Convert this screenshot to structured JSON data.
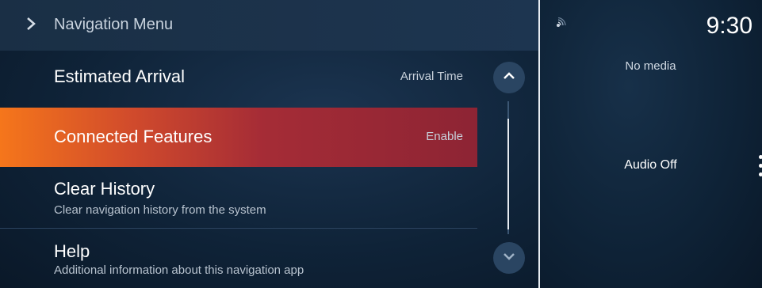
{
  "header": {
    "title": "Navigation Menu"
  },
  "menu": [
    {
      "title": "Estimated Arrival",
      "value": "Arrival Time"
    },
    {
      "title": "Connected Features",
      "value": "Enable"
    },
    {
      "title": "Clear History",
      "subtitle": "Clear navigation history from the system"
    },
    {
      "title": "Help",
      "subtitle": "Additional information about this navigation app"
    }
  ],
  "status": {
    "time": "9:30"
  },
  "media": {
    "no_media": "No media",
    "audio_state": "Audio Off"
  },
  "icons": {
    "header": "chevron-right-icon",
    "scroll_up": "chevron-up-icon",
    "scroll_down": "chevron-down-icon",
    "status": "wireless-signal-icon"
  },
  "colors": {
    "accent_start": "#f5761b",
    "accent_end": "#8d2434"
  }
}
